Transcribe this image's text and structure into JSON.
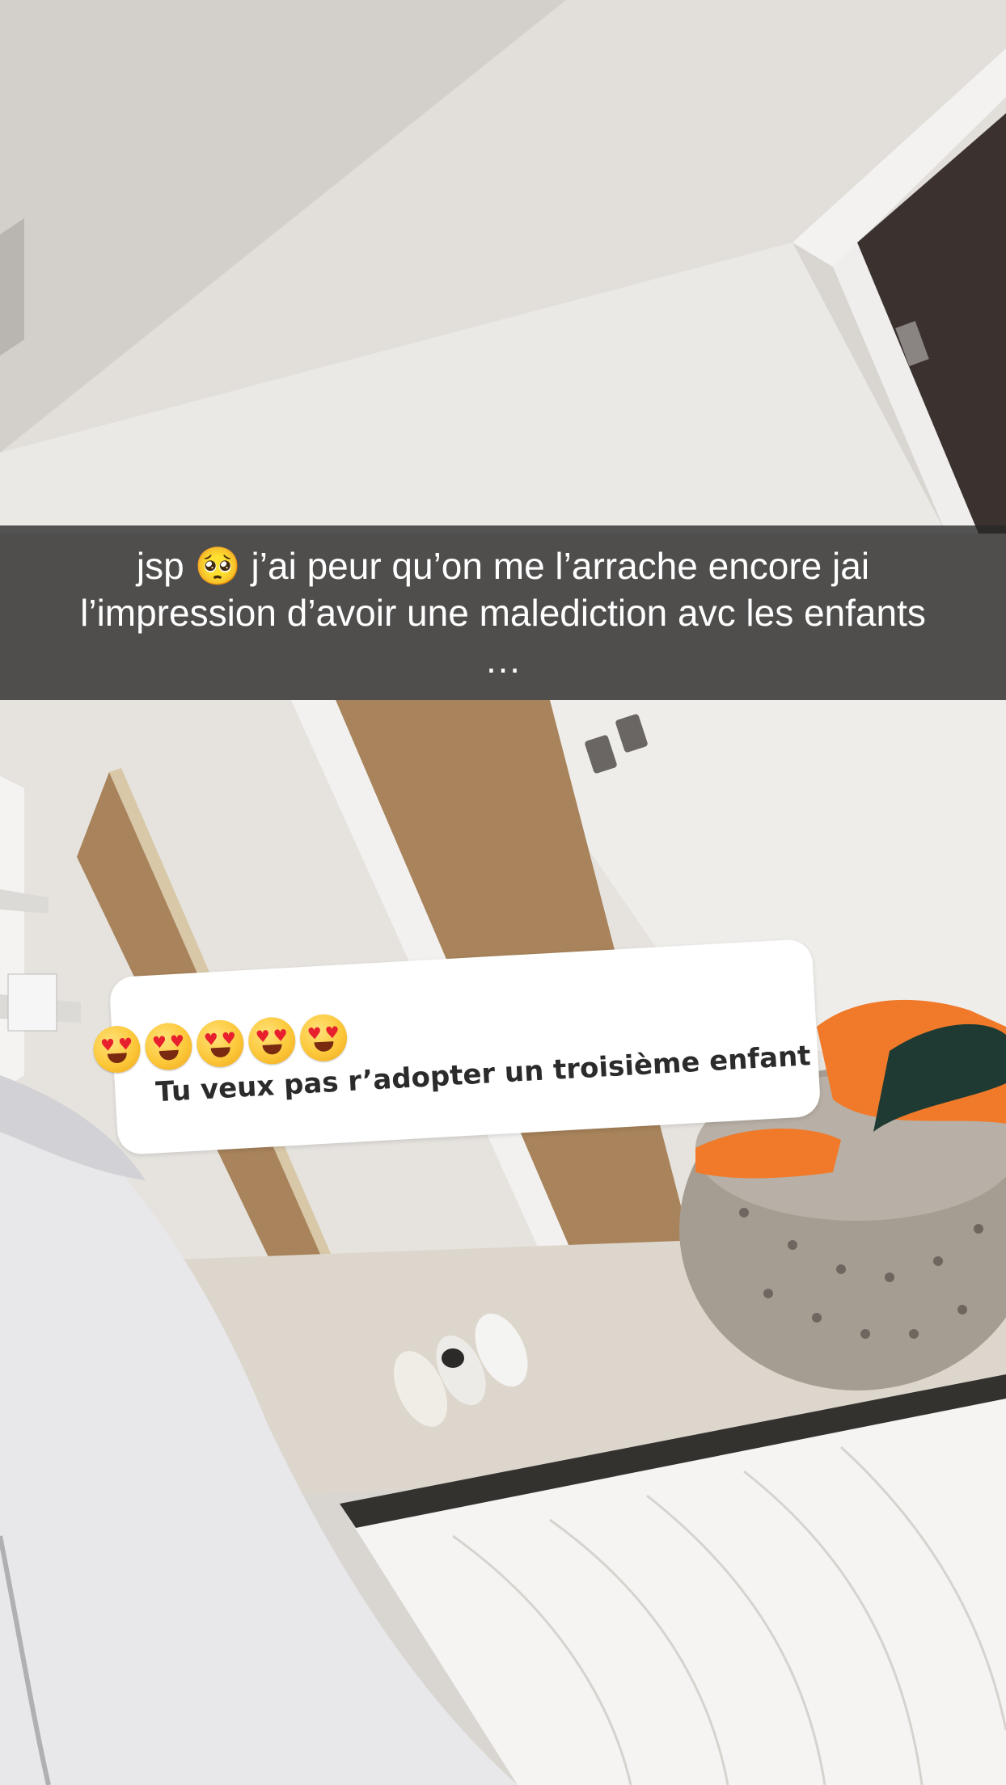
{
  "caption": {
    "text": "jsp 🥺 j’ai peur qu’on me l’arrache encore jai\nl’impression d’avoir une malediction avc les enfants\n…"
  },
  "question_sticker": {
    "question": "Tu veux pas r’adopter un troisième enfant",
    "emoji_icon": "heart-eyes-face",
    "emoji_count": 5
  },
  "colors": {
    "caption_bar": "#282828",
    "caption_text": "#ffffff",
    "sticker_background": "#ffffff",
    "sticker_text": "#2b2b2b",
    "clothes_orange": "#f07a2a"
  }
}
